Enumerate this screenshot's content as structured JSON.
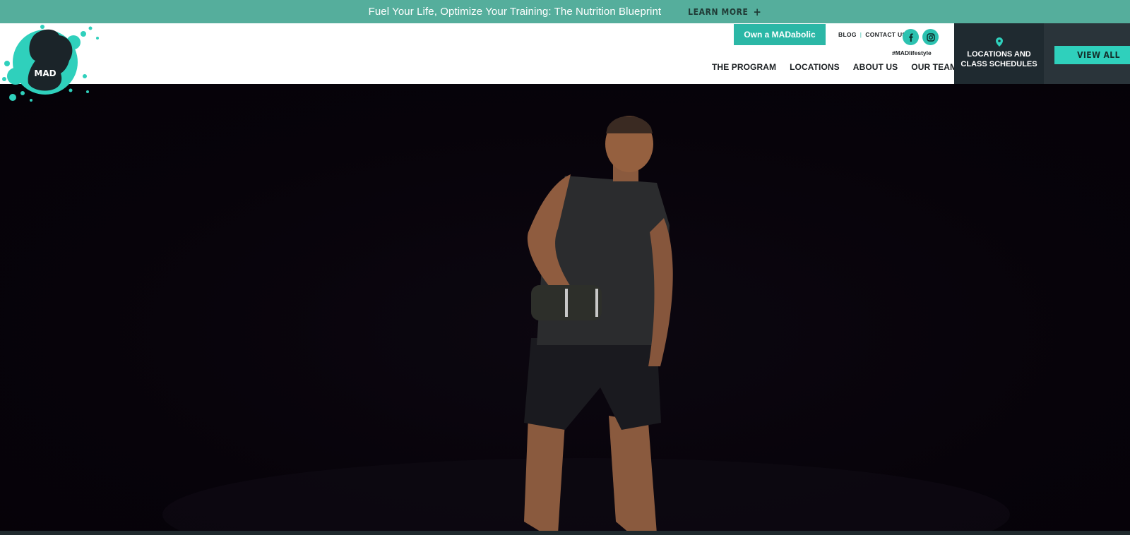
{
  "announcement": {
    "message": "Fuel Your Life, Optimize Your Training: The Nutrition Blueprint",
    "cta_label": "LEARN MORE"
  },
  "header": {
    "logo_text": "MAD",
    "own_button_label": "Own a MADabolic",
    "utility_links": [
      "BLOG",
      "CONTACT US"
    ],
    "social_icons": [
      "facebook-icon",
      "instagram-icon"
    ],
    "hashtag": "#MADlifestyle",
    "nav": [
      "THE PROGRAM",
      "LOCATIONS",
      "ABOUT US",
      "OUR TEAM"
    ],
    "locations_label_line1": "LOCATIONS AND",
    "locations_label_line2": "CLASS SCHEDULES",
    "view_all_label": "VIEW ALL"
  },
  "colors": {
    "announcement_bg": "#55ae9c",
    "accent": "#2bb7a6",
    "dark_panel": "#1f2a30",
    "hero_bg": "#07030a"
  }
}
